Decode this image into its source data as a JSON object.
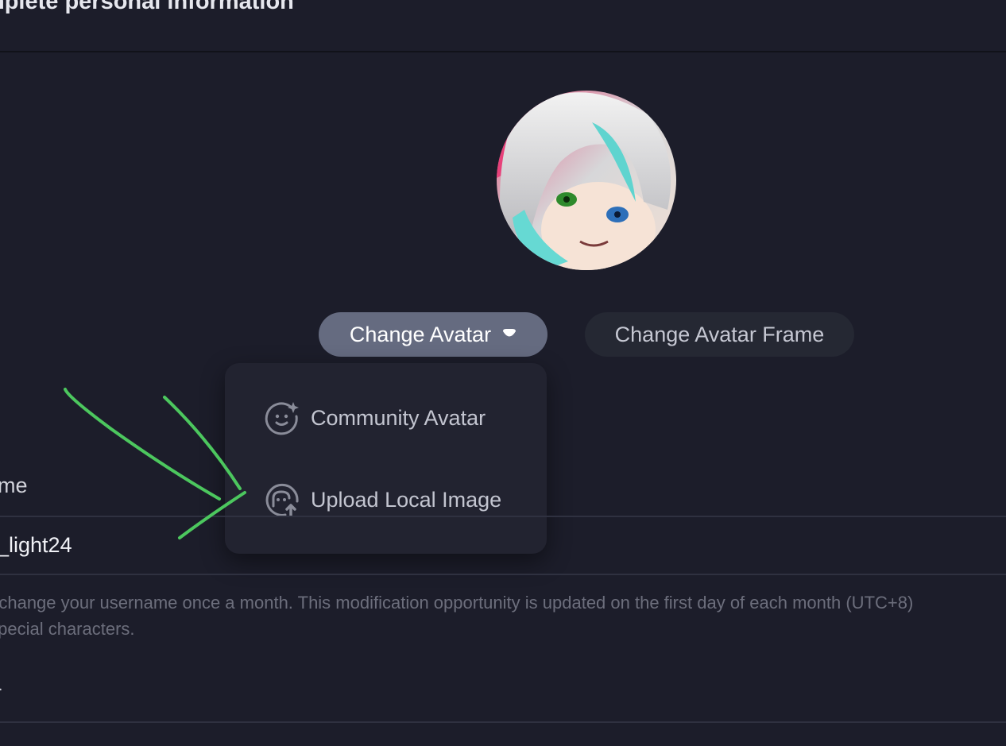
{
  "header": {
    "title": "nplete personal information"
  },
  "avatar": {
    "alt": "anime avatar"
  },
  "buttons": {
    "change_avatar": "Change Avatar",
    "change_avatar_frame": "Change Avatar Frame"
  },
  "dropdown": {
    "items": [
      {
        "label": "Community Avatar",
        "icon": "community-avatar-icon"
      },
      {
        "label": "Upload Local Image",
        "icon": "upload-image-icon"
      }
    ]
  },
  "form": {
    "username_label": "ame",
    "username_value": "_light24",
    "username_hint": "n change your username once a month. This modification opportunity is updated on the first day of each month (UTC+8)\n special characters.",
    "next_label": "er"
  },
  "colors": {
    "background": "#1c1d2a",
    "primary_button": "#656b80",
    "secondary_button": "#252833",
    "dropdown_bg": "#222330",
    "annotation_arrow": "#4cc75e"
  }
}
